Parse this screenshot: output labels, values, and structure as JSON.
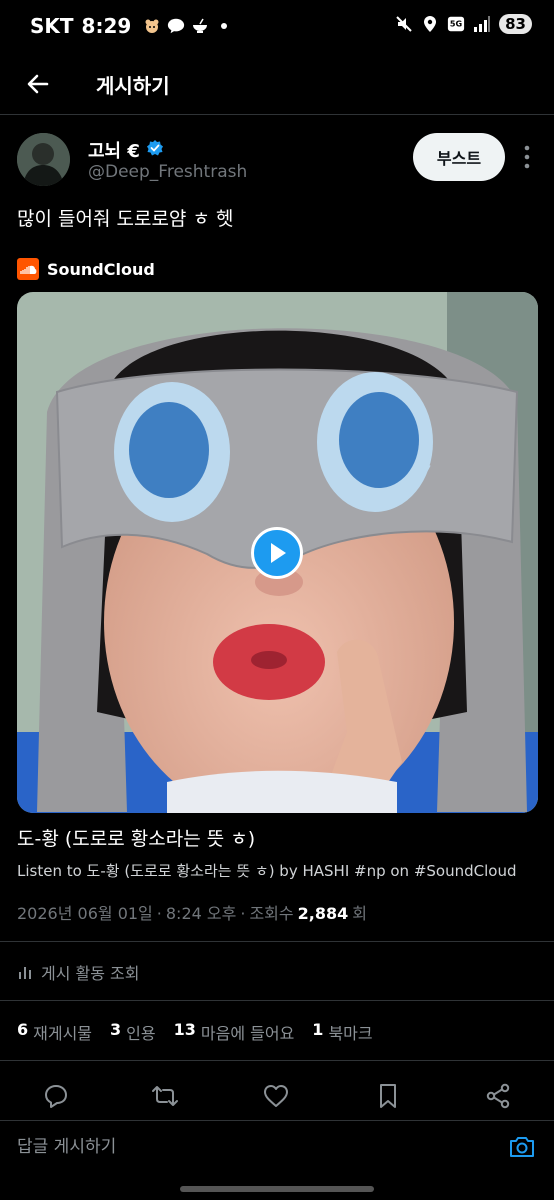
{
  "status_bar": {
    "carrier": "SKT",
    "time": "8:29",
    "network": "5G",
    "battery": "83",
    "icons": [
      "hamster-icon",
      "talk-icon",
      "bowl-icon",
      "dot-icon",
      "mute-icon",
      "location-icon",
      "signal-icon",
      "battery-icon"
    ]
  },
  "header": {
    "title": "게시하기",
    "back_icon": "arrow-left-icon"
  },
  "post": {
    "author_name": "고뇌 €",
    "handle": "@Deep_Freshtrash",
    "verified": true,
    "boost_label": "부스트",
    "text": "많이 들어줘 도로로얌 ㅎ 헷",
    "card": {
      "source": "SoundCloud",
      "title": "도-황 (도로로 황소라는 뜻 ㅎ)",
      "description": "Listen to 도-황 (도로로 황소라는 뜻 ㅎ) by HASHI #np on #SoundCloud"
    },
    "meta": {
      "date": "2026년 06월 01일",
      "sep": "·",
      "time": "8:24 오후",
      "views_label": "조회수",
      "views": "2,884",
      "views_unit": "회"
    },
    "activity_label": "게시 활동 조회",
    "stats": {
      "reposts_count": "6",
      "reposts_label": "재게시물",
      "quotes_count": "3",
      "quotes_label": "인용",
      "likes_count": "13",
      "likes_label": "마음에 들어요",
      "bookmarks_count": "1",
      "bookmarks_label": "북마크"
    }
  },
  "reply": {
    "placeholder": "답글 게시하기"
  },
  "colors": {
    "accent": "#1d9bf0",
    "soundcloud": "#ff5500",
    "background": "#000000",
    "muted_text": "#71767b"
  }
}
